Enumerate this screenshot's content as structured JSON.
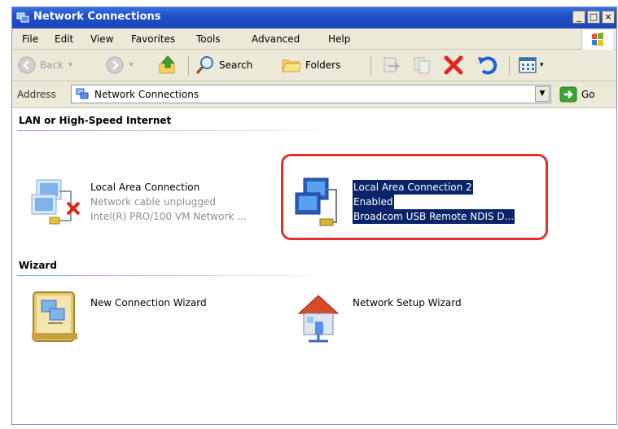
{
  "window": {
    "title": "Network Connections"
  },
  "menu": [
    "File",
    "Edit",
    "View",
    "Favorites",
    "Tools",
    "Advanced",
    "Help"
  ],
  "toolbar": {
    "back": "Back",
    "search": "Search",
    "folders": "Folders"
  },
  "address": {
    "label": "Address",
    "value": "Network Connections",
    "go": "Go"
  },
  "groups": [
    {
      "title": "LAN or High-Speed Internet",
      "items": [
        {
          "name": "Local Area Connection",
          "status": "Network cable unplugged",
          "device": "Intel(R) PRO/100 VM Network ..."
        },
        {
          "name": "Local Area Connection 2",
          "status": "Enabled",
          "device": "Broadcom USB Remote NDIS D..."
        }
      ]
    },
    {
      "title": "Wizard",
      "items": [
        {
          "name": "New Connection Wizard"
        },
        {
          "name": "Network Setup Wizard"
        }
      ]
    }
  ],
  "colors": {
    "selection": "#0a246a",
    "highlight_ring": "#e03030",
    "titlebar": "#1f50c8"
  }
}
